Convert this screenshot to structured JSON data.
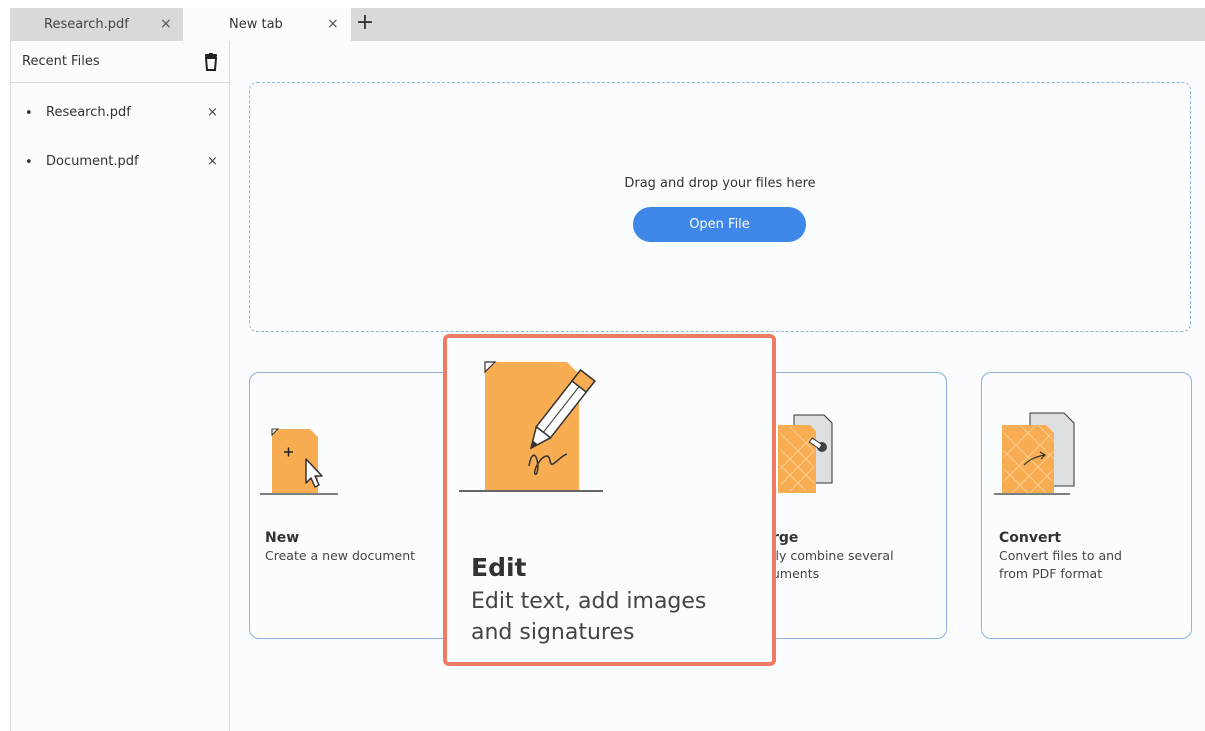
{
  "tabs": [
    {
      "label": "Research.pdf",
      "close": "×"
    },
    {
      "label": "New tab",
      "close": "×"
    }
  ],
  "new_tab": "+",
  "sidebar": {
    "title": "Recent Files",
    "items": [
      {
        "bullet": "•",
        "label": "Research.pdf",
        "remove": "×"
      },
      {
        "bullet": "•",
        "label": "Document.pdf",
        "remove": "×"
      }
    ]
  },
  "dropzone": {
    "text": "Drag and drop your files here",
    "button": "Open File"
  },
  "cards": {
    "new": {
      "title": "New",
      "desc": "Create a new document",
      "icon": "new-document-icon"
    },
    "merge": {
      "title": "rge",
      "desc_1": "ily combine several",
      "desc_2": "uments",
      "icon": "merge-icon"
    },
    "convert": {
      "title": "Convert",
      "desc_1": "Convert files to and",
      "desc_2": "from PDF format",
      "icon": "convert-icon"
    },
    "edit": {
      "title": "Edit",
      "desc_1": "Edit text, add images",
      "desc_2": "and signatures",
      "icon": "edit-pencil-icon"
    }
  },
  "colors": {
    "accent": "#3e86e8",
    "highlight_border": "#f07b63",
    "card_border": "#8fb0dc",
    "doc_orange": "#f9ad52"
  }
}
